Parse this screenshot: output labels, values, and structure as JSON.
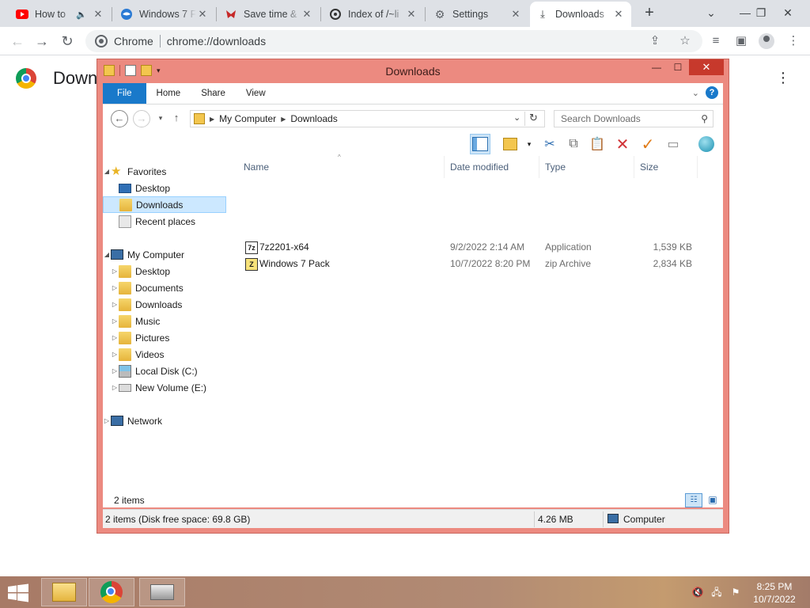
{
  "browser": {
    "tabs": [
      {
        "label": "How to",
        "icon": "youtube-icon",
        "audio": true
      },
      {
        "label": "Windows 7 F",
        "icon": "site-icon"
      },
      {
        "label": "Save time &",
        "icon": "site-icon"
      },
      {
        "label": "Index of /~li",
        "icon": "site-icon"
      },
      {
        "label": "Settings",
        "icon": "gear-icon"
      },
      {
        "label": "Downloads",
        "icon": "download-icon",
        "active": true
      }
    ],
    "omnibox": {
      "chip": "Chrome",
      "url": "chrome://downloads"
    },
    "page_title": "Downloads"
  },
  "explorer": {
    "title": "Downloads",
    "ribbon_tabs": [
      "File",
      "Home",
      "Share",
      "View"
    ],
    "breadcrumb": [
      "My Computer",
      "Downloads"
    ],
    "search_placeholder": "Search Downloads",
    "nav": {
      "favorites": {
        "label": "Favorites",
        "items": [
          "Desktop",
          "Downloads",
          "Recent places"
        ]
      },
      "computer": {
        "label": "My Computer",
        "items": [
          "Desktop",
          "Documents",
          "Downloads",
          "Music",
          "Pictures",
          "Videos",
          "Local Disk (C:)",
          "New Volume (E:)"
        ]
      },
      "network": {
        "label": "Network"
      }
    },
    "columns": {
      "name": "Name",
      "date": "Date modified",
      "type": "Type",
      "size": "Size"
    },
    "files": [
      {
        "name": "7z2201-x64",
        "date": "9/2/2022 2:14 AM",
        "type": "Application",
        "size": "1,539 KB",
        "icon": "7zip-icon"
      },
      {
        "name": "Windows 7 Pack",
        "date": "10/7/2022 8:20 PM",
        "type": "zip Archive",
        "size": "2,834 KB",
        "icon": "zip-icon"
      }
    ],
    "item_count": "2 items",
    "status": {
      "left": "2 items (Disk free space: 69.8 GB)",
      "size": "4.26 MB",
      "location": "Computer"
    }
  },
  "taskbar": {
    "clock_time": "8:25 PM",
    "clock_date": "10/7/2022"
  }
}
